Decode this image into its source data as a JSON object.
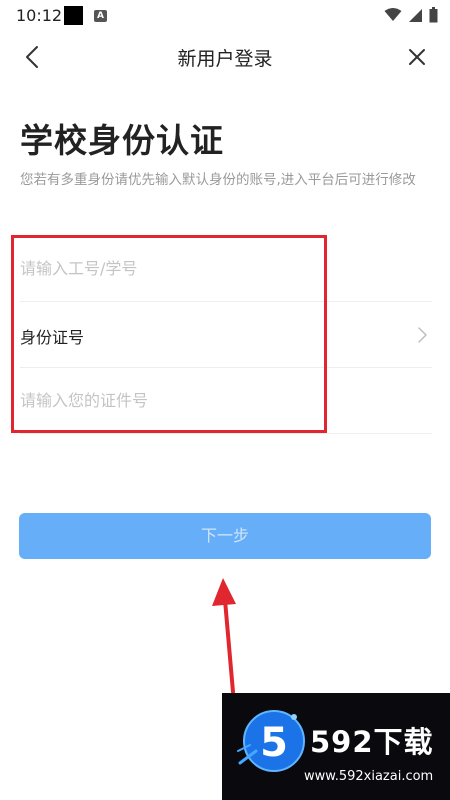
{
  "status_bar": {
    "time": "10:12"
  },
  "nav": {
    "title": "新用户登录"
  },
  "main": {
    "title": "学校身份认证",
    "subtitle": "您若有多重身份请优先输入默认身份的账号,进入平台后可进行修改"
  },
  "form": {
    "id_placeholder": "请输入工号/学号",
    "id_type_label": "身份证号",
    "cert_placeholder": "请输入您的证件号"
  },
  "next_button": {
    "label": "下一步"
  },
  "watermark": {
    "text": "592下载",
    "url": "www.592xiazai.com",
    "logo_digit": "5"
  },
  "colors": {
    "button": "#66aef7",
    "button_text": "#cfe5fc",
    "highlight": "#e0262f",
    "placeholder": "#c4c4c4"
  }
}
